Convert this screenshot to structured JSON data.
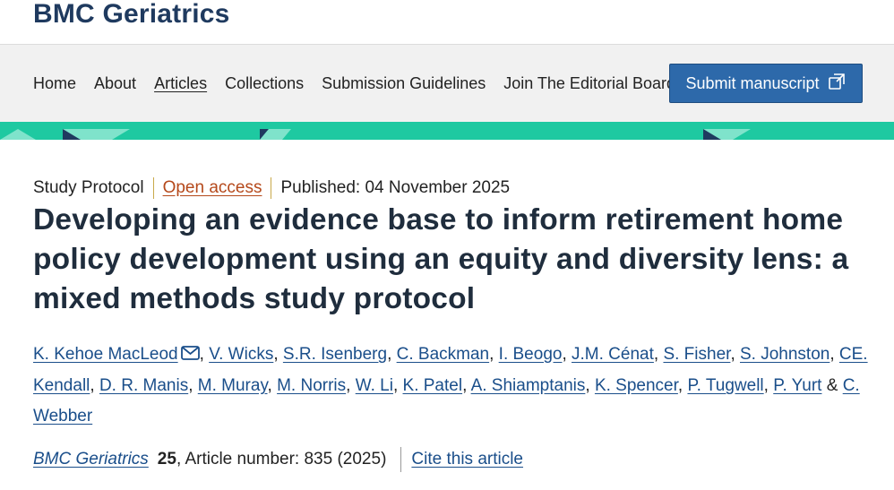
{
  "header": {
    "journal_title": "BMC Geriatrics"
  },
  "nav": {
    "links": [
      "Home",
      "About",
      "Articles",
      "Collections",
      "Submission Guidelines",
      "Join The Editorial Board"
    ],
    "active": "Articles",
    "submit_label": "Submit manuscript"
  },
  "colors": {
    "brand": "#1f3a5f",
    "band": "#1ec9a1",
    "button": "#2d69aa",
    "link": "#1a4e8a",
    "open_access": "#b5491b"
  },
  "icons": {
    "submit": "external-window-icon",
    "mail": "mail-icon"
  },
  "article": {
    "type": "Study Protocol",
    "access": "Open access",
    "published": "Published: 04 November 2025",
    "title": "Developing an evidence base to inform retirement home policy development using an equity and diversity lens: a mixed methods study protocol",
    "authors": [
      "K. Kehoe MacLeod",
      "V. Wicks",
      "S.R. Isenberg",
      "C. Backman",
      "I. Beogo",
      "J.M. Cénat",
      "S. Fisher",
      "S. Johnston",
      "CE. Kendall",
      "D. R. Manis",
      "M. Muray",
      "M. Norris",
      "W. Li",
      "K. Patel",
      "A. Shiamptanis",
      "K. Spencer",
      "P. Tugwell",
      "P. Yurt",
      "C. Webber"
    ],
    "author_separator": ", ",
    "last_separator": " & ",
    "citation": {
      "journal": "BMC Geriatrics",
      "volume": "25",
      "article_number": ", Article number: 835 (2025)",
      "cite_label": "Cite this article"
    }
  }
}
